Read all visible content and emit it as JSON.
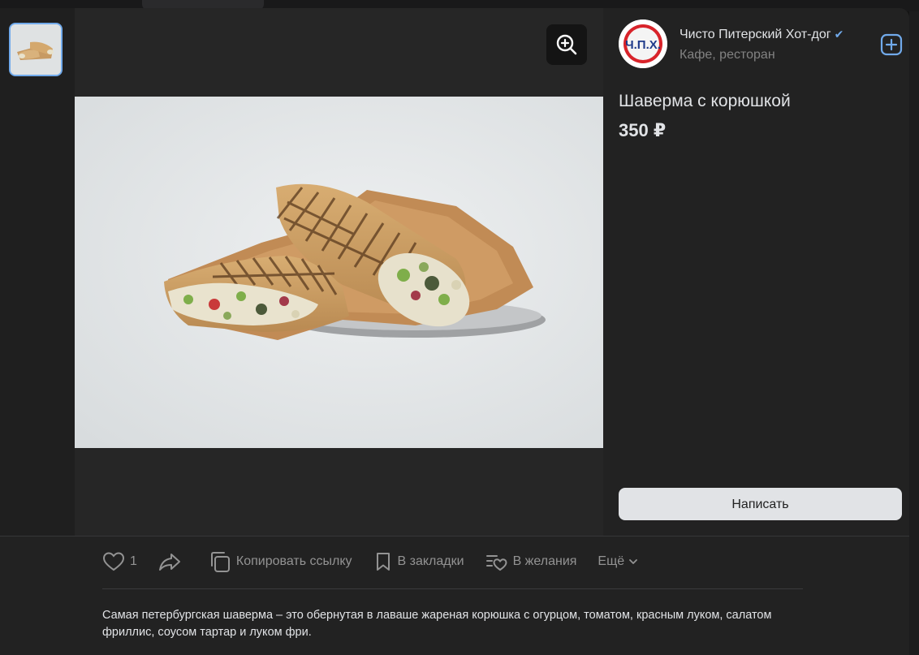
{
  "shop": {
    "name": "Чисто Питерский Хот-дог",
    "category": "Кафе, ресторан",
    "logo_text": "Ч.П.Х."
  },
  "product": {
    "title": "Шаверма с корюшкой",
    "price": "350 ₽",
    "description": "Самая петербургская шаверма – это обернутая в лаваше жареная корюшка с огурцом, томатом, красным луком, салатом фриллис, соусом тартар и луком фри."
  },
  "buttons": {
    "write": "Написать"
  },
  "actions": {
    "like_count": "1",
    "copy_link": "Копировать ссылку",
    "bookmarks": "В закладки",
    "wishlist": "В желания",
    "more": "Ещё"
  },
  "colors": {
    "accent": "#71aaeb",
    "modal_bg": "#222222",
    "button_bg": "#e1e3e6"
  },
  "icons": [
    "zoom-in-icon",
    "verified-icon",
    "add-icon",
    "heart-icon",
    "share-icon",
    "copy-icon",
    "bookmark-icon",
    "wishlist-icon",
    "chevron-down-icon"
  ]
}
